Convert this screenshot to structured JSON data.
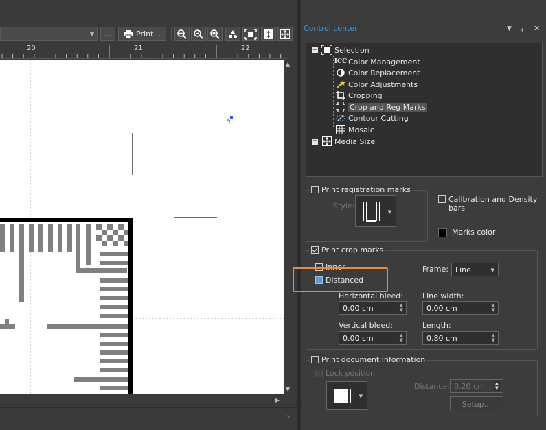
{
  "toolbar": {
    "more_label": "...",
    "print_label": "Print...",
    "icons": [
      "zoom-in-icon",
      "zoom-out-icon",
      "zoom-selection-icon",
      "shapes-icon",
      "fit-selection-icon",
      "fit-height-icon",
      "fit-page-icon"
    ]
  },
  "ruler": {
    "marks": [
      "20",
      "21",
      "22"
    ]
  },
  "panel": {
    "title": "Control center",
    "tree": {
      "root": "Selection",
      "items": [
        "Color Management",
        "Color Replacement",
        "Color Adjustments",
        "Cropping",
        "Crop and Reg Marks",
        "Contour Cutting",
        "Mosaic"
      ],
      "selected": "Crop and Reg Marks",
      "second_root": "Media Size"
    },
    "registration": {
      "label": "Print registration marks",
      "style_label": "Style:",
      "calibration_label": "Calibration and Density bars",
      "marks_color_label": "Marks color",
      "marks_color": "#000000"
    },
    "crop": {
      "label": "Print crop marks",
      "inner_label": "Inner",
      "distanced_label": "Distanced",
      "frame_label": "Frame:",
      "frame_value": "Line",
      "hbleed_label": "Horizontal bleed:",
      "hbleed_value": "0.00 cm",
      "line_width_label": "Line width:",
      "line_width_value": "0.00 cm",
      "vbleed_label": "Vertical bleed:",
      "vbleed_value": "0.00 cm",
      "length_label": "Length:",
      "length_value": "0.80 cm"
    },
    "docinfo": {
      "label": "Print document information",
      "lock_label": "Lock position",
      "distance_label": "Distance:",
      "distance_value": "0.20 cm",
      "setup_label": "Setup..."
    }
  },
  "colors": {
    "accent": "#3c9ce4",
    "highlight": "#f0883a"
  }
}
